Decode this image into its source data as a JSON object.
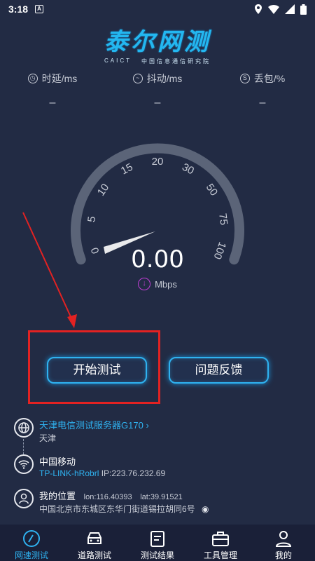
{
  "statusbar": {
    "time": "3:18"
  },
  "logo": {
    "name": "泰尔网测",
    "caict": "CAICT",
    "org": "中国信息通信研究院"
  },
  "metrics": [
    {
      "label": "时延/ms",
      "value": "–"
    },
    {
      "label": "抖动/ms",
      "value": "–"
    },
    {
      "label": "丢包/%",
      "value": "–"
    }
  ],
  "gauge": {
    "ticks": [
      "0",
      "5",
      "10",
      "15",
      "20",
      "30",
      "50",
      "75",
      "100"
    ]
  },
  "speed": {
    "value": "0.00",
    "unit": "Mbps"
  },
  "buttons": {
    "start": "开始测试",
    "feedback": "问题反馈"
  },
  "server": {
    "name": "天津电信测试服务器G170",
    "city": "天津"
  },
  "network": {
    "carrier": "中国移动",
    "ssid": "TP-LINK-hRobrl",
    "ip": "IP:223.76.232.69"
  },
  "location": {
    "title": "我的位置",
    "lon": "lon:116.40393",
    "lat": "lat:39.91521",
    "address": "中国北京市东城区东华门街道锡拉胡同6号"
  },
  "tabs": [
    "网速测试",
    "道路测试",
    "测试结果",
    "工具管理",
    "我的"
  ],
  "colors": {
    "accent": "#2fb2f0",
    "background": "#222b44",
    "highlight_box": "#e32222"
  }
}
